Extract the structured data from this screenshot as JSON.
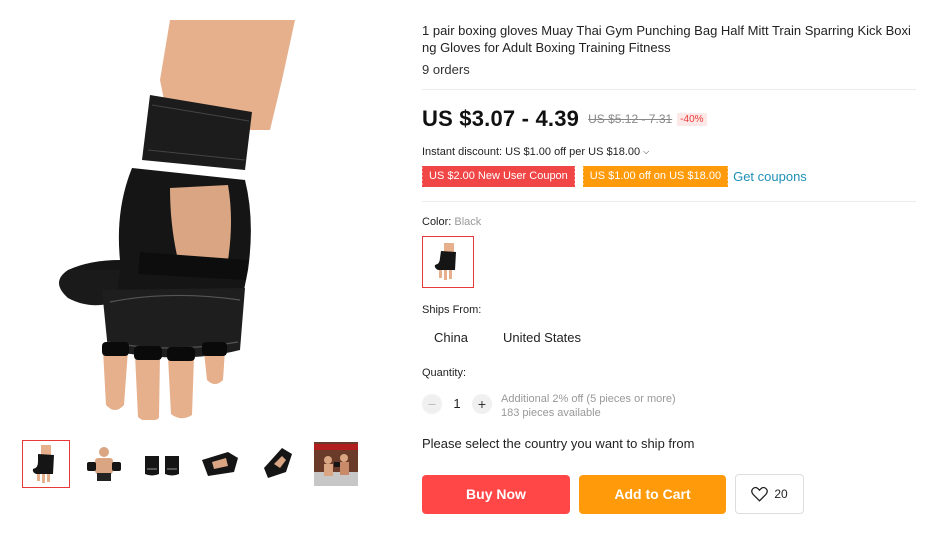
{
  "product": {
    "title": "1 pair boxing gloves Muay Thai Gym Punching Bag Half Mitt Train Sparring Kick Boxing Gloves for Adult Boxing Training Fitness",
    "orders": "9 orders",
    "price": "US $3.07 - 4.39",
    "old_price": "US $5.12 - 7.31",
    "discount": "-40%",
    "instant_discount": "Instant discount: US $1.00 off per US $18.00",
    "coupons": [
      {
        "label": "US $2.00 New User Coupon",
        "color": "#f04646"
      },
      {
        "label": "US $1.00 off on US $18.00",
        "color": "#ff9a0a"
      }
    ],
    "get_coupons": "Get coupons"
  },
  "color": {
    "label": "Color:",
    "value": "Black"
  },
  "ships_from": {
    "label": "Ships From:",
    "options": [
      "China",
      "United States"
    ]
  },
  "quantity": {
    "label": "Quantity:",
    "value": "1",
    "minus": "−",
    "plus": "+",
    "additional": "Additional 2% off (5 pieces or more)",
    "available": "183 pieces available"
  },
  "ship_message": "Please select the country you want to ship from",
  "actions": {
    "buy_now": "Buy Now",
    "add_to_cart": "Add to Cart",
    "wishlist_count": "20"
  },
  "gallery": {
    "thumbnails": [
      "glove-front",
      "boxer-pose",
      "glove-pair",
      "glove-side",
      "glove-angle",
      "fight-scene"
    ],
    "active_index": 0
  },
  "colors": {
    "buy_now": "#ff4747",
    "add_to_cart": "#ff9a0a",
    "link": "#1f8fb6",
    "accent": "#e93a3a"
  }
}
